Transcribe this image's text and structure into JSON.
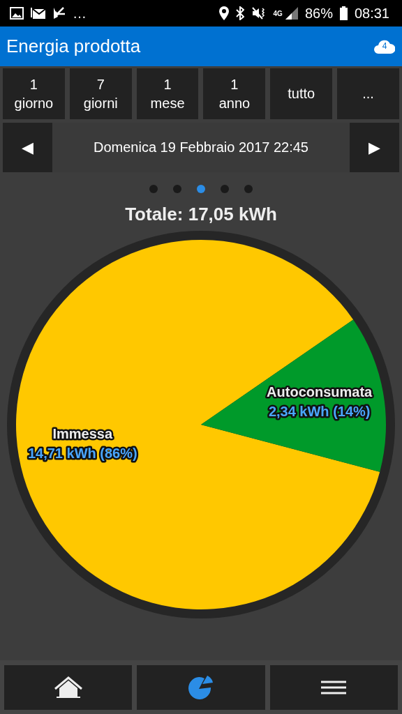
{
  "status_bar": {
    "more": "…",
    "network": "4G",
    "battery": "86%",
    "time": "08:31"
  },
  "header": {
    "title": "Energia prodotta",
    "cloud_badge": "4"
  },
  "ranges": [
    {
      "label": "1\ngiorno"
    },
    {
      "label": "7\ngiorni"
    },
    {
      "label": "1\nmese"
    },
    {
      "label": "1\nanno"
    },
    {
      "label": "tutto"
    },
    {
      "label": "..."
    }
  ],
  "date_nav": {
    "prev": "◀",
    "date": "Domenica 19 Febbraio 2017 22:45",
    "next": "▶"
  },
  "pages": [
    {
      "selected": false
    },
    {
      "selected": false
    },
    {
      "selected": true
    },
    {
      "selected": false
    },
    {
      "selected": false
    }
  ],
  "total": "Totale: 17,05 kWh",
  "chart_data": {
    "type": "pie",
    "categories": [
      "Immessa",
      "Autoconsumata"
    ],
    "values": [
      14.71,
      2.34
    ],
    "colors": [
      "#ffc800",
      "#009a2a"
    ],
    "value_labels": [
      "14,71 kWh (86%)",
      "2,34 kWh (14%)"
    ]
  },
  "bottom_nav": [
    {
      "kind": "home",
      "selected": false
    },
    {
      "kind": "chart",
      "selected": true
    },
    {
      "kind": "menu",
      "selected": false
    }
  ]
}
